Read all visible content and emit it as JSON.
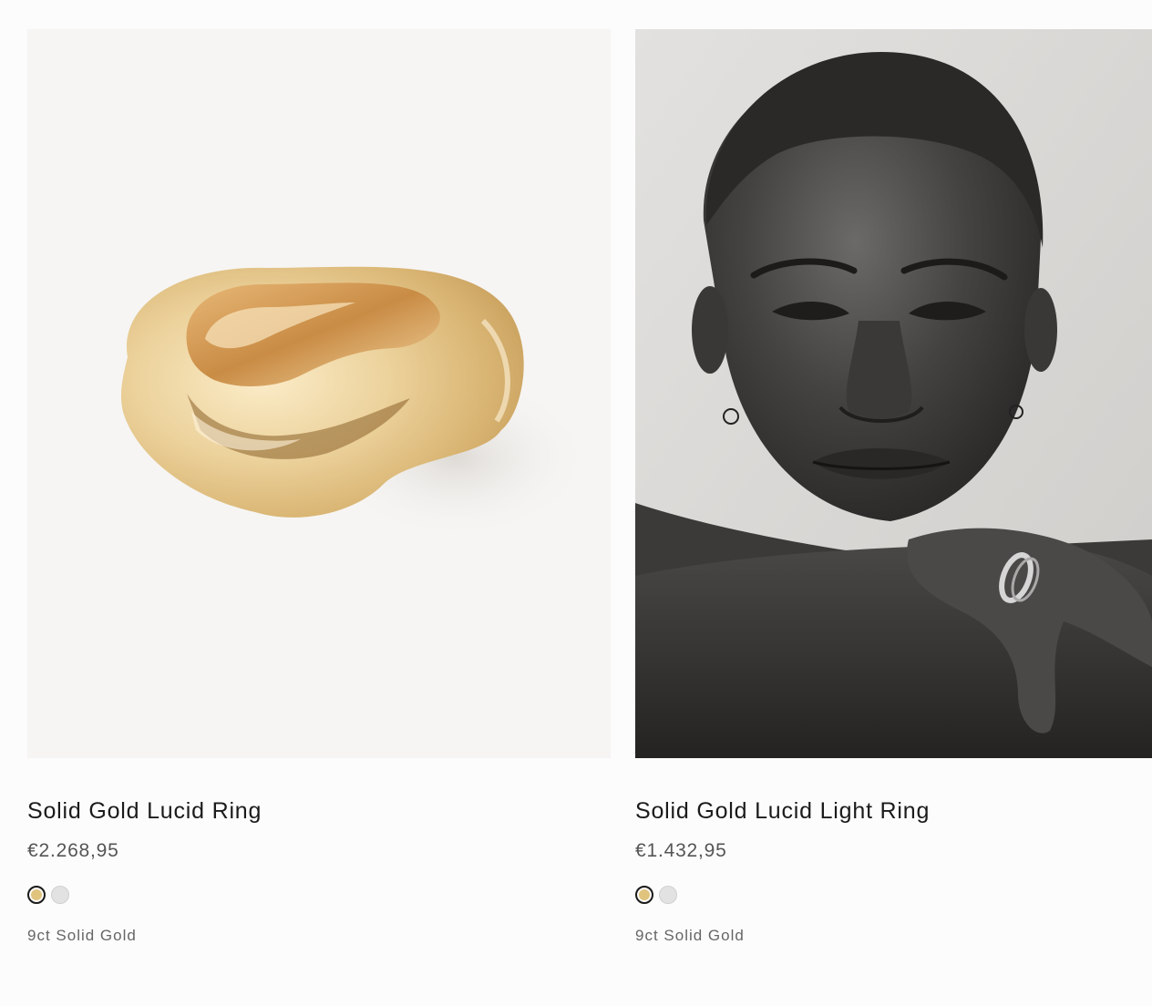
{
  "products": [
    {
      "title": "Solid Gold Lucid Ring",
      "price": "€2.268,95",
      "material": "9ct Solid Gold",
      "image": "gold-ring-product-shot",
      "swatches": [
        {
          "name": "gold",
          "color": "#e0c47e",
          "selected": true
        },
        {
          "name": "silver",
          "color": "#e2e2e2",
          "selected": false
        }
      ]
    },
    {
      "title": "Solid Gold Lucid Light Ring",
      "price": "€1.432,95",
      "material": "9ct Solid Gold",
      "image": "model-portrait-black-and-white",
      "swatches": [
        {
          "name": "gold",
          "color": "#e0c47e",
          "selected": true
        },
        {
          "name": "silver",
          "color": "#e2e2e2",
          "selected": false
        }
      ]
    }
  ]
}
